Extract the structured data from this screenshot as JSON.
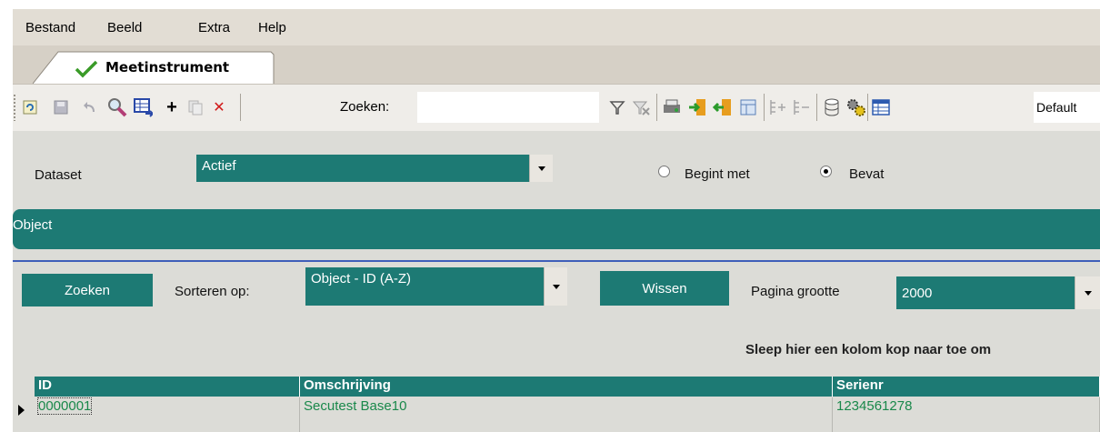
{
  "menu": {
    "items": [
      "Bestand",
      "Beeld",
      "Extra",
      "Help"
    ]
  },
  "tab": {
    "label": "Meetinstrument"
  },
  "toolbar": {
    "search_label": "Zoeken:",
    "search_value": "",
    "layout_value": "Default"
  },
  "filters": {
    "dataset_label": "Dataset",
    "dataset_value": "Actief",
    "radio_starts_label": "Begint met",
    "radio_contains_label": "Bevat",
    "radio_selected": "Bevat"
  },
  "section": {
    "title": "Object"
  },
  "search_bar": {
    "search_button": "Zoeken",
    "sort_label": "Sorteren op:",
    "sort_value": "Object - ID (A-Z)",
    "clear_button": "Wissen",
    "page_size_label": "Pagina grootte",
    "page_size_value": "2000"
  },
  "grid": {
    "group_hint": "Sleep hier een kolom kop naar toe om",
    "columns": [
      "ID",
      "Omschrijving",
      "Serienr"
    ],
    "rows": [
      [
        "0000001",
        "Secutest Base10",
        "1234561278"
      ]
    ]
  },
  "colors": {
    "accent": "#1d7a74",
    "rule": "#3f5fb9",
    "cell_text": "#19884a"
  }
}
